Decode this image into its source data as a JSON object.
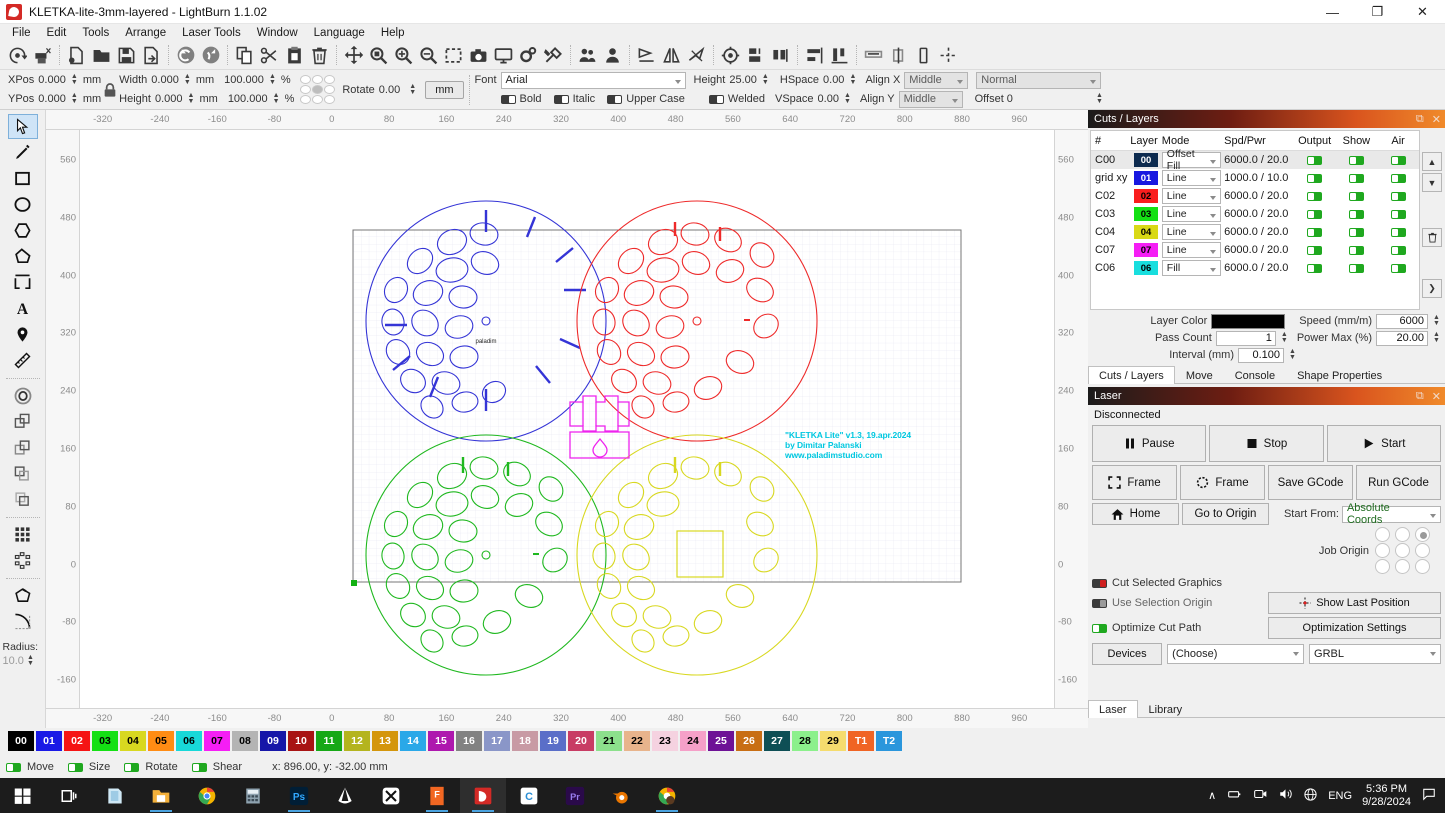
{
  "window": {
    "title": "KLETKA-lite-3mm-layered - LightBurn 1.1.02",
    "minimize": "—",
    "maximize": "❐",
    "close": "✕"
  },
  "menubar": [
    "File",
    "Edit",
    "Tools",
    "Arrange",
    "Laser Tools",
    "Window",
    "Language",
    "Help"
  ],
  "toolbar": {
    "icons": [
      "refresh-icon",
      "print-cut-icon",
      "new-file-icon",
      "open-folder-icon",
      "save-icon",
      "save-as-icon",
      "undo-icon",
      "redo-icon",
      "copy-icon",
      "cut-icon",
      "paste-icon",
      "delete-icon",
      "move-icon",
      "zoom-fit-icon",
      "zoom-in-icon",
      "zoom-out-icon",
      "zoom-selection-icon",
      "camera-icon",
      "preview-icon",
      "settings-gear-icon",
      "device-settings-icon",
      "group-icon",
      "ungroup-icon",
      "flip-horizontal-icon",
      "mirror-icon",
      "close-path-icon",
      "set-origin-icon",
      "align-group-icon",
      "weld-icon",
      "align-left-icon",
      "align-vertical-icon",
      "distribute-icon",
      "spacing-icon",
      "center-icon"
    ]
  },
  "properties": {
    "xpos_label": "XPos",
    "xpos_value": "0.000",
    "ypos_label": "YPos",
    "ypos_value": "0.000",
    "unit_mm": "mm",
    "width_label": "Width",
    "width_value": "0.000",
    "height_label": "Height",
    "height_value": "0.000",
    "width_pct": "100.000",
    "height_pct": "100.000",
    "percent": "%",
    "rotate_label": "Rotate",
    "rotate_value": "0.00",
    "units_button": "mm",
    "font_label": "Font",
    "font_value": "Arial",
    "height_text_label": "Height",
    "height_text_value": "25.00",
    "hspace_label": "HSpace",
    "hspace_value": "0.00",
    "vspace_label": "VSpace",
    "vspace_value": "0.00",
    "alignx_label": "Align X",
    "alignx_value": "Middle",
    "aligny_label": "Align Y",
    "aligny_value": "Middle",
    "normal_value": "Normal",
    "offset_label": "Offset 0",
    "bold_label": "Bold",
    "italic_label": "Italic",
    "uppercase_label": "Upper Case",
    "welded_label": "Welded"
  },
  "left_tools": {
    "items": [
      {
        "name": "select-tool",
        "selected": true
      },
      {
        "name": "pencil-draw-tool",
        "selected": false
      },
      {
        "name": "rectangle-tool",
        "selected": false
      },
      {
        "name": "ellipse-tool",
        "selected": false
      },
      {
        "name": "polygon-tool",
        "selected": false
      },
      {
        "name": "closed-shape-tool",
        "selected": false
      },
      {
        "name": "edit-nodes-tool",
        "selected": false
      },
      {
        "name": "text-tool",
        "selected": false
      },
      {
        "name": "position-marker-tool",
        "selected": false
      },
      {
        "name": "measure-tool",
        "selected": false
      },
      {
        "name": "offset-shapes-tool",
        "selected": false
      },
      {
        "name": "boolean-union-tool",
        "selected": false
      },
      {
        "name": "boolean-subtract-tool",
        "selected": false
      },
      {
        "name": "boolean-intersect-tool",
        "selected": false
      },
      {
        "name": "boolean-exclude-tool",
        "selected": false
      },
      {
        "name": "grid-array-tool",
        "selected": false
      },
      {
        "name": "circular-array-tool",
        "selected": false
      },
      {
        "name": "trim-tool",
        "selected": false
      },
      {
        "name": "fillet-radius-tool",
        "selected": false
      }
    ],
    "radius_label": "Radius:",
    "radius_value": "10.0"
  },
  "canvas": {
    "h_ticks": [
      "-320",
      "-240",
      "-160",
      "-80",
      "0",
      "80",
      "160",
      "240",
      "320",
      "400",
      "480",
      "560",
      "640",
      "720",
      "800",
      "880",
      "960"
    ],
    "v_ticks": [
      "560",
      "480",
      "400",
      "320",
      "240",
      "160",
      "80",
      "0",
      "-80",
      "-160"
    ],
    "annotation": "\"KLETKA Lite\" v1.3, 19.apr.2024\nby Dimitar Palanski\nwww.paladimstudio.com",
    "annotation_color": "#00c8e0",
    "watermark": "paladim",
    "layer_colors": {
      "blue": "#3434d6",
      "red": "#ee2a2a",
      "green": "#1fb81f",
      "yellow": "#d8d820",
      "magenta": "#ee22ee",
      "black": "#000000"
    }
  },
  "cuts_panel": {
    "title": "Cuts / Layers",
    "columns": [
      "#",
      "Layer",
      "Mode",
      "Spd/Pwr",
      "Output",
      "Show",
      "Air"
    ],
    "rows": [
      {
        "num": "C00",
        "layer": "00",
        "color": "#0d2b4f",
        "text_color": "#ffffff",
        "mode": "Offset Fill",
        "spd": "6000.0 / 20.0",
        "output": true,
        "show": true,
        "air": true,
        "selected": true
      },
      {
        "num": "grid xy",
        "layer": "01",
        "color": "#1818e0",
        "text_color": "#ffffff",
        "mode": "Line",
        "spd": "1000.0 / 10.0",
        "output": true,
        "show": true,
        "air": true,
        "selected": false
      },
      {
        "num": "C02",
        "layer": "02",
        "color": "#fa1e1e",
        "text_color": "#000000",
        "mode": "Line",
        "spd": "6000.0 / 20.0",
        "output": true,
        "show": true,
        "air": true,
        "selected": false
      },
      {
        "num": "C03",
        "layer": "03",
        "color": "#14e014",
        "text_color": "#000000",
        "mode": "Line",
        "spd": "6000.0 / 20.0",
        "output": true,
        "show": true,
        "air": true,
        "selected": false
      },
      {
        "num": "C04",
        "layer": "04",
        "color": "#d9d916",
        "text_color": "#000000",
        "mode": "Line",
        "spd": "6000.0 / 20.0",
        "output": true,
        "show": true,
        "air": true,
        "selected": false
      },
      {
        "num": "C07",
        "layer": "07",
        "color": "#f51ef5",
        "text_color": "#000000",
        "mode": "Line",
        "spd": "6000.0 / 20.0",
        "output": true,
        "show": true,
        "air": true,
        "selected": false
      },
      {
        "num": "C06",
        "layer": "06",
        "color": "#18dede",
        "text_color": "#000000",
        "mode": "Fill",
        "spd": "6000.0 / 20.0",
        "output": true,
        "show": true,
        "air": true,
        "selected": false
      }
    ],
    "layer_color_label": "Layer Color",
    "layer_color_value": "#000000",
    "pass_count_label": "Pass Count",
    "pass_count_value": "1",
    "interval_label": "Interval (mm)",
    "interval_value": "0.100",
    "speed_label": "Speed (mm/m)",
    "speed_value": "6000",
    "power_label": "Power Max (%)",
    "power_value": "20.00",
    "tabs": [
      {
        "label": "Cuts / Layers",
        "active": true
      },
      {
        "label": "Move",
        "active": false
      },
      {
        "label": "Console",
        "active": false
      },
      {
        "label": "Shape Properties",
        "active": false
      }
    ]
  },
  "laser_panel": {
    "title": "Laser",
    "status": "Disconnected",
    "pause": "Pause",
    "stop": "Stop",
    "start": "Start",
    "frame_square": "Frame",
    "frame_round": "Frame",
    "save_gcode": "Save GCode",
    "run_gcode": "Run GCode",
    "home": "Home",
    "go_to_origin": "Go to Origin",
    "start_from_label": "Start From:",
    "start_from_value": "Absolute Coords",
    "job_origin_label": "Job Origin",
    "job_origin_selected": 2,
    "cut_selected_label": "Cut Selected Graphics",
    "use_selection_label": "Use Selection Origin",
    "optimize_label": "Optimize Cut Path",
    "show_last_position": "Show Last Position",
    "optimization_settings": "Optimization Settings",
    "devices_button": "Devices",
    "device_value": "(Choose)",
    "protocol_value": "GRBL",
    "tabs": [
      {
        "label": "Laser",
        "active": true
      },
      {
        "label": "Library",
        "active": false
      }
    ]
  },
  "palette": {
    "chips": [
      {
        "label": "00",
        "color": "#000000",
        "text": "#ffffff"
      },
      {
        "label": "01",
        "color": "#1a1ae6",
        "text": "#ffffff"
      },
      {
        "label": "02",
        "color": "#f51414",
        "text": "#ffffff"
      },
      {
        "label": "03",
        "color": "#14e014",
        "text": "#000000"
      },
      {
        "label": "04",
        "color": "#d8d820",
        "text": "#000000"
      },
      {
        "label": "05",
        "color": "#ff8c14",
        "text": "#000000"
      },
      {
        "label": "06",
        "color": "#18d8d8",
        "text": "#000000"
      },
      {
        "label": "07",
        "color": "#f51ef5",
        "text": "#000000"
      },
      {
        "label": "08",
        "color": "#b4b4b4",
        "text": "#000000"
      },
      {
        "label": "09",
        "color": "#1616a8",
        "text": "#ffffff"
      },
      {
        "label": "10",
        "color": "#a81414",
        "text": "#ffffff"
      },
      {
        "label": "11",
        "color": "#16a816",
        "text": "#ffffff"
      },
      {
        "label": "12",
        "color": "#b4b41e",
        "text": "#ffffff"
      },
      {
        "label": "13",
        "color": "#d4960c",
        "text": "#ffffff"
      },
      {
        "label": "14",
        "color": "#2aa8e8",
        "text": "#ffffff"
      },
      {
        "label": "15",
        "color": "#ae18ae",
        "text": "#ffffff"
      },
      {
        "label": "16",
        "color": "#828282",
        "text": "#ffffff"
      },
      {
        "label": "17",
        "color": "#8a96c8",
        "text": "#ffffff"
      },
      {
        "label": "18",
        "color": "#c89aa4",
        "text": "#ffffff"
      },
      {
        "label": "19",
        "color": "#5a6ec8",
        "text": "#ffffff"
      },
      {
        "label": "20",
        "color": "#c83c64",
        "text": "#ffffff"
      },
      {
        "label": "21",
        "color": "#8ce08c",
        "text": "#000000"
      },
      {
        "label": "22",
        "color": "#e8b48c",
        "text": "#000000"
      },
      {
        "label": "23",
        "color": "#f5d2e0",
        "text": "#000000"
      },
      {
        "label": "24",
        "color": "#f5a0c8",
        "text": "#000000"
      },
      {
        "label": "25",
        "color": "#6e1296",
        "text": "#ffffff"
      },
      {
        "label": "26",
        "color": "#c86e14",
        "text": "#ffffff"
      },
      {
        "label": "27",
        "color": "#0e4f55",
        "text": "#ffffff"
      },
      {
        "label": "28",
        "color": "#8cf08c",
        "text": "#000000"
      },
      {
        "label": "29",
        "color": "#f5dc6e",
        "text": "#000000"
      },
      {
        "label": "T1",
        "color": "#f06424",
        "text": "#ffffff"
      },
      {
        "label": "T2",
        "color": "#2a96dc",
        "text": "#ffffff"
      }
    ]
  },
  "statusbar": {
    "move_label": "Move",
    "size_label": "Size",
    "rotate_label": "Rotate",
    "shear_label": "Shear",
    "coords": "x: 896.00, y: -32.00 mm"
  },
  "taskbar": {
    "items": [
      "windows-start-icon",
      "task-view-icon",
      "file-explorer-blue-icon",
      "file-explorer-icon",
      "chrome-icon",
      "calculator-icon",
      "photoshop-icon",
      "inkscape-icon",
      "capcut-icon",
      "fusion360-icon",
      "lightburn-icon",
      "c-app-icon",
      "premiere-pro-icon",
      "blender-icon",
      "chrome-profile-icon"
    ],
    "tray": {
      "chevron": "chevron-up-icon",
      "battery": "battery-icon",
      "camera": "camera-icon",
      "volume": "volume-icon",
      "network": "network-icon",
      "language": "ENG",
      "time": "5:36 PM",
      "date": "9/28/2024",
      "notifications": "notification-icon"
    }
  }
}
